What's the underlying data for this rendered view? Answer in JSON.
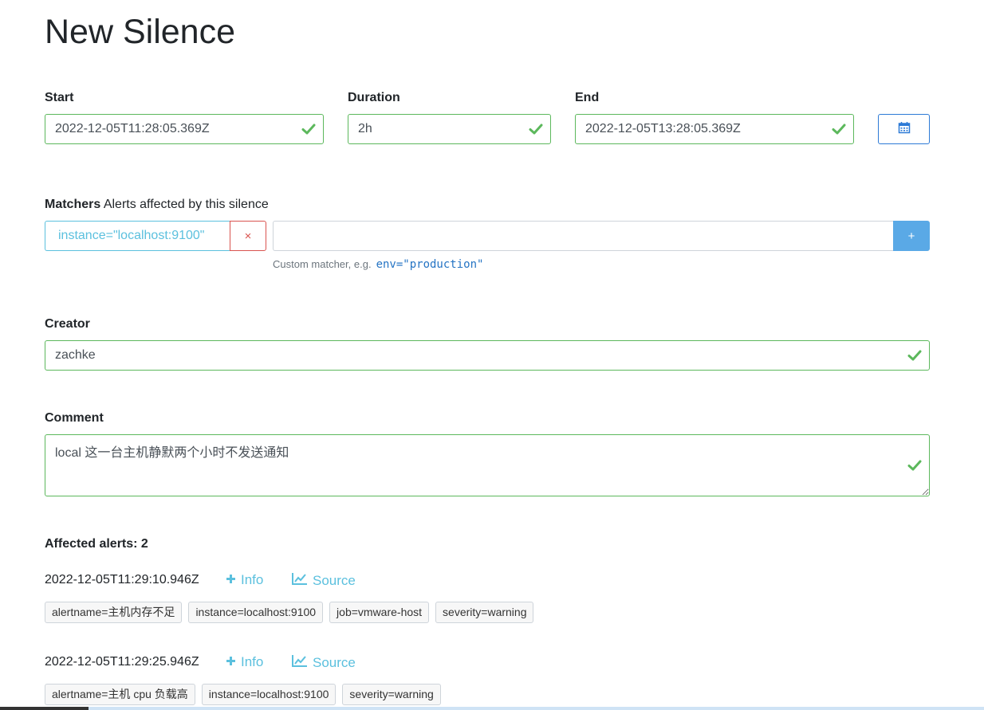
{
  "page_title": "New Silence",
  "fields": {
    "start": {
      "label": "Start",
      "value": "2022-12-05T11:28:05.369Z"
    },
    "duration": {
      "label": "Duration",
      "value": "2h"
    },
    "end": {
      "label": "End",
      "value": "2022-12-05T13:28:05.369Z"
    }
  },
  "matchers": {
    "label": "Matchers",
    "sublabel": "Alerts affected by this silence",
    "chips": [
      {
        "text": "instance=\"localhost:9100\"",
        "remove": "×"
      }
    ],
    "input_value": "",
    "add_label": "+",
    "hint_prefix": "Custom matcher, e.g.",
    "hint_example": "env=\"production\""
  },
  "creator": {
    "label": "Creator",
    "value": "zachke"
  },
  "comment": {
    "label": "Comment",
    "value": "local 这一台主机静默两个小时不发送通知"
  },
  "affected": {
    "label": "Affected alerts: 2",
    "alerts": [
      {
        "time": "2022-12-05T11:29:10.946Z",
        "info": "Info",
        "source": "Source",
        "labels": [
          "alertname=主机内存不足",
          "instance=localhost:9100",
          "job=vmware-host",
          "severity=warning"
        ]
      },
      {
        "time": "2022-12-05T11:29:25.946Z",
        "info": "Info",
        "source": "Source",
        "labels": [
          "alertname=主机 cpu 负载高",
          "instance=localhost:9100",
          "severity=warning"
        ]
      }
    ]
  },
  "colors": {
    "valid": "#5cb85c",
    "info": "#5bc0de",
    "danger": "#d9534f",
    "primary": "#2d7ad6"
  },
  "icons": {
    "valid": "check-icon",
    "calendar": "calendar-icon",
    "info": "plus-icon",
    "source": "line-chart-icon"
  }
}
